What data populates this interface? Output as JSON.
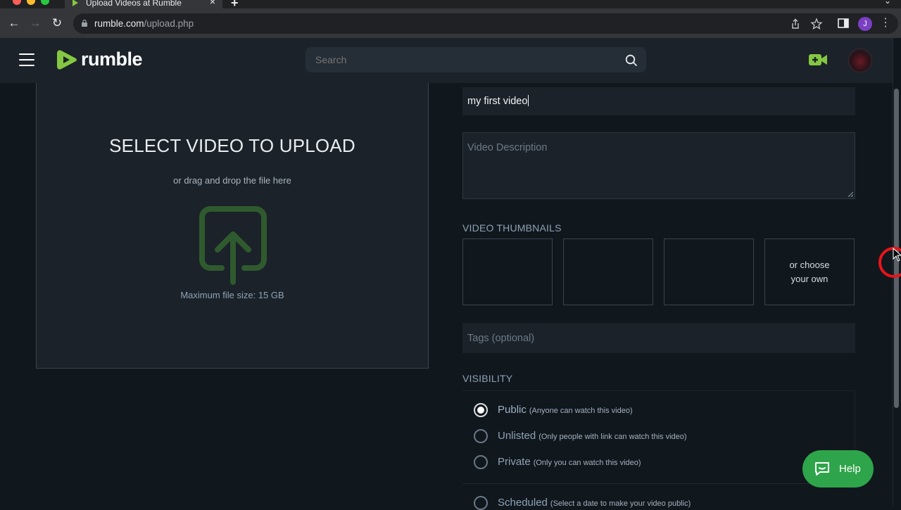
{
  "browser": {
    "tab_title": "Upload Videos at Rumble",
    "url_domain": "rumble.com",
    "url_path": "/upload.php",
    "profile_initial": "J"
  },
  "header": {
    "logo_text": "rumble",
    "search_placeholder": "Search"
  },
  "upload": {
    "title": "SELECT VIDEO TO UPLOAD",
    "subtitle": "or drag and drop the file here",
    "max_size": "Maximum file size: 15 GB"
  },
  "form": {
    "title_value": "my first video",
    "description_placeholder": "Video Description",
    "thumbnails_label": "VIDEO THUMBNAILS",
    "choose_own_line1": "or choose",
    "choose_own_line2": "your own",
    "tags_placeholder": "Tags (optional)",
    "visibility_label": "VISIBILITY",
    "visibility_options": [
      {
        "name": "Public",
        "desc": "(Anyone can watch this video)",
        "selected": true
      },
      {
        "name": "Unlisted",
        "desc": "(Only people with link can watch this video)",
        "selected": false
      },
      {
        "name": "Private",
        "desc": "(Only you can watch this video)",
        "selected": false
      },
      {
        "name": "Scheduled",
        "desc": "(Select a date to make your video public)",
        "selected": false
      }
    ]
  },
  "help": {
    "label": "Help"
  },
  "colors": {
    "brand_green": "#85c742",
    "help_green": "#2ea54a",
    "page_bg": "#10171d",
    "panel_bg": "#1b2229"
  }
}
